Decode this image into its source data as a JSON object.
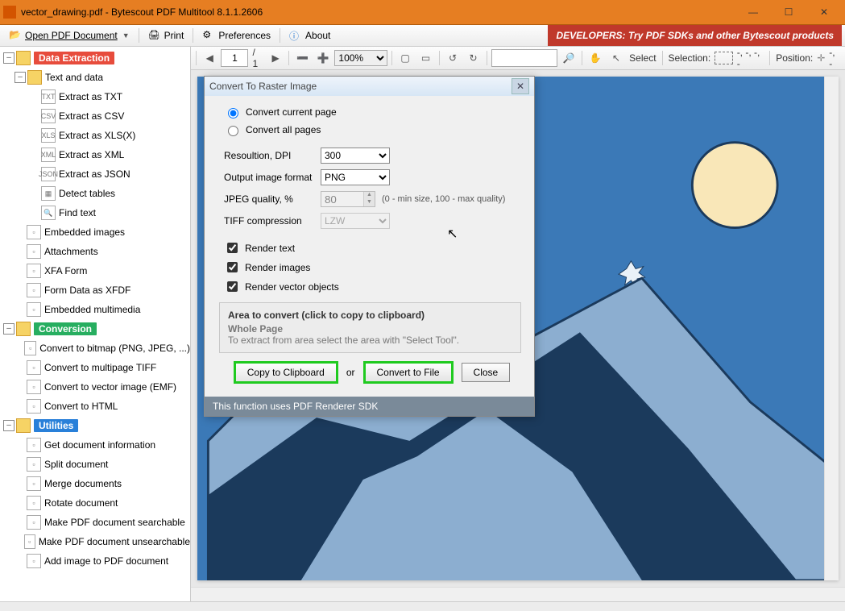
{
  "window": {
    "title": "vector_drawing.pdf - Bytescout PDF Multitool 8.1.1.2606"
  },
  "menubar": {
    "open": "Open PDF Document",
    "print": "Print",
    "prefs": "Preferences",
    "about": "About",
    "banner": "DEVELOPERS: Try PDF SDKs and other Bytescout products"
  },
  "sidebar": {
    "dataExtraction": "Data Extraction",
    "textAndData": "Text and data",
    "items1": [
      "Extract as TXT",
      "Extract as CSV",
      "Extract as XLS(X)",
      "Extract as XML",
      "Extract as JSON",
      "Detect tables",
      "Find text"
    ],
    "ext1": [
      "TXT",
      "CSV",
      "XLS",
      "XML",
      "JSON",
      "▦",
      "🔍"
    ],
    "items1b": [
      "Embedded images",
      "Attachments",
      "XFA Form",
      "Form Data as XFDF",
      "Embedded multimedia"
    ],
    "conversion": "Conversion",
    "items2": [
      "Convert to bitmap (PNG, JPEG, ...)",
      "Convert to multipage TIFF",
      "Convert to vector image (EMF)",
      "Convert to HTML"
    ],
    "utilities": "Utilities",
    "items3": [
      "Get document information",
      "Split document",
      "Merge documents",
      "Rotate document",
      "Make PDF document searchable",
      "Make PDF document unsearchable",
      "Add image to PDF document"
    ]
  },
  "toolbar": {
    "page": "1",
    "pages": "/ 1",
    "zoom": "100%",
    "select": "Select",
    "selection": "Selection:",
    "selv": "-, -, -, -",
    "position": "Position:",
    "posv": "-, -"
  },
  "dialog": {
    "title": "Convert To Raster Image",
    "r1": "Convert current page",
    "r2": "Convert all pages",
    "dpiL": "Resoultion, DPI",
    "dpiV": "300",
    "fmtL": "Output image format",
    "fmtV": "PNG",
    "jqL": "JPEG quality, %",
    "jqV": "80",
    "jqH": "(0 - min size, 100 - max quality)",
    "tcL": "TIFF compression",
    "tcV": "LZW",
    "c1": "Render text",
    "c2": "Render images",
    "c3": "Render vector objects",
    "areaT": "Area to convert (click to copy to clipboard)",
    "areaW": "Whole Page",
    "areaH": "To extract from area select the area with \"Select Tool\".",
    "b1": "Copy to Clipboard",
    "bor": "or",
    "b2": "Convert to File",
    "b3": "Close",
    "foot": "This function uses PDF Renderer SDK"
  }
}
